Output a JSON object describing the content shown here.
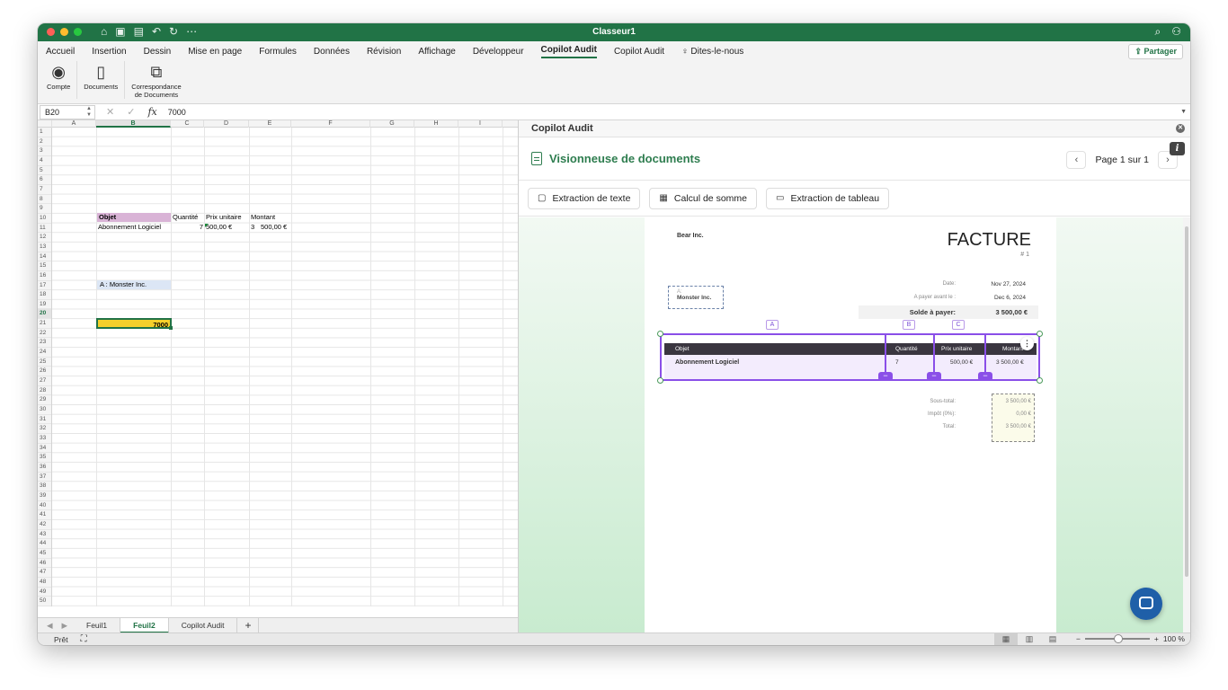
{
  "window": {
    "title": "Classeur1"
  },
  "menu": [
    "Accueil",
    "Insertion",
    "Dessin",
    "Mise en page",
    "Formules",
    "Données",
    "Révision",
    "Affichage",
    "Développeur",
    "Copilot Audit",
    "Copilot Audit",
    "Dites-le-nous"
  ],
  "share_label": "Partager",
  "ribbon": {
    "compte": "Compte",
    "documents": "Documents",
    "correspondance_1": "Correspondance",
    "correspondance_2": "de Documents"
  },
  "formula_bar": {
    "name_box": "B20",
    "value": "7000"
  },
  "columns": [
    "A",
    "B",
    "C",
    "D",
    "E",
    "F",
    "G",
    "H",
    "I"
  ],
  "cells": {
    "b9": "Objet",
    "c9": "Quantité",
    "d9": "Prix unitaire",
    "e9": "Montant",
    "b10": "Abonnement Logiciel",
    "c10": "7",
    "d10": "500,00 €",
    "e10a": "3",
    "e10b": "500,00 €",
    "b16": "A :  Monster Inc.",
    "b20": "7000"
  },
  "sheet_tabs": [
    "Feuil1",
    "Feuil2",
    "Copilot Audit",
    "+"
  ],
  "status": {
    "ready": "Prêt",
    "zoom": "100 %"
  },
  "pane": {
    "title": "Copilot Audit",
    "viewer_title": "Visionneuse de documents",
    "page": "Page 1 sur 1",
    "buttons": [
      "Extraction de texte",
      "Calcul de somme",
      "Extraction de tableau"
    ]
  },
  "invoice": {
    "company": "Bear Inc.",
    "title": "FACTURE",
    "number": "# 1",
    "to_label": "A:",
    "to_value": "Monster Inc.",
    "date_label": "Date:",
    "date_value": "Nov 27, 2024",
    "due_label": "A payer avant le :",
    "due_value": "Dec 6, 2024",
    "balance_label": "Solde à payer:",
    "balance_value": "3 500,00 €",
    "col_labels": [
      "A",
      "B",
      "C"
    ],
    "headers": [
      "Objet",
      "Quantité",
      "Prix unitaire",
      "Montant"
    ],
    "row": [
      "Abonnement Logiciel",
      "7",
      "500,00 €",
      "3 500,00 €"
    ],
    "subtotal_label": "Sous-total:",
    "subtotal_value": "3 500,00 €",
    "tax_label": "Impôt (0%):",
    "tax_value": "0,00 €",
    "total_label": "Total:",
    "total_value": "3 500,00 €"
  },
  "colors": {
    "accent": "#217346",
    "selection": "#8a4fe8",
    "highlight_yellow": "#f5d02b"
  }
}
